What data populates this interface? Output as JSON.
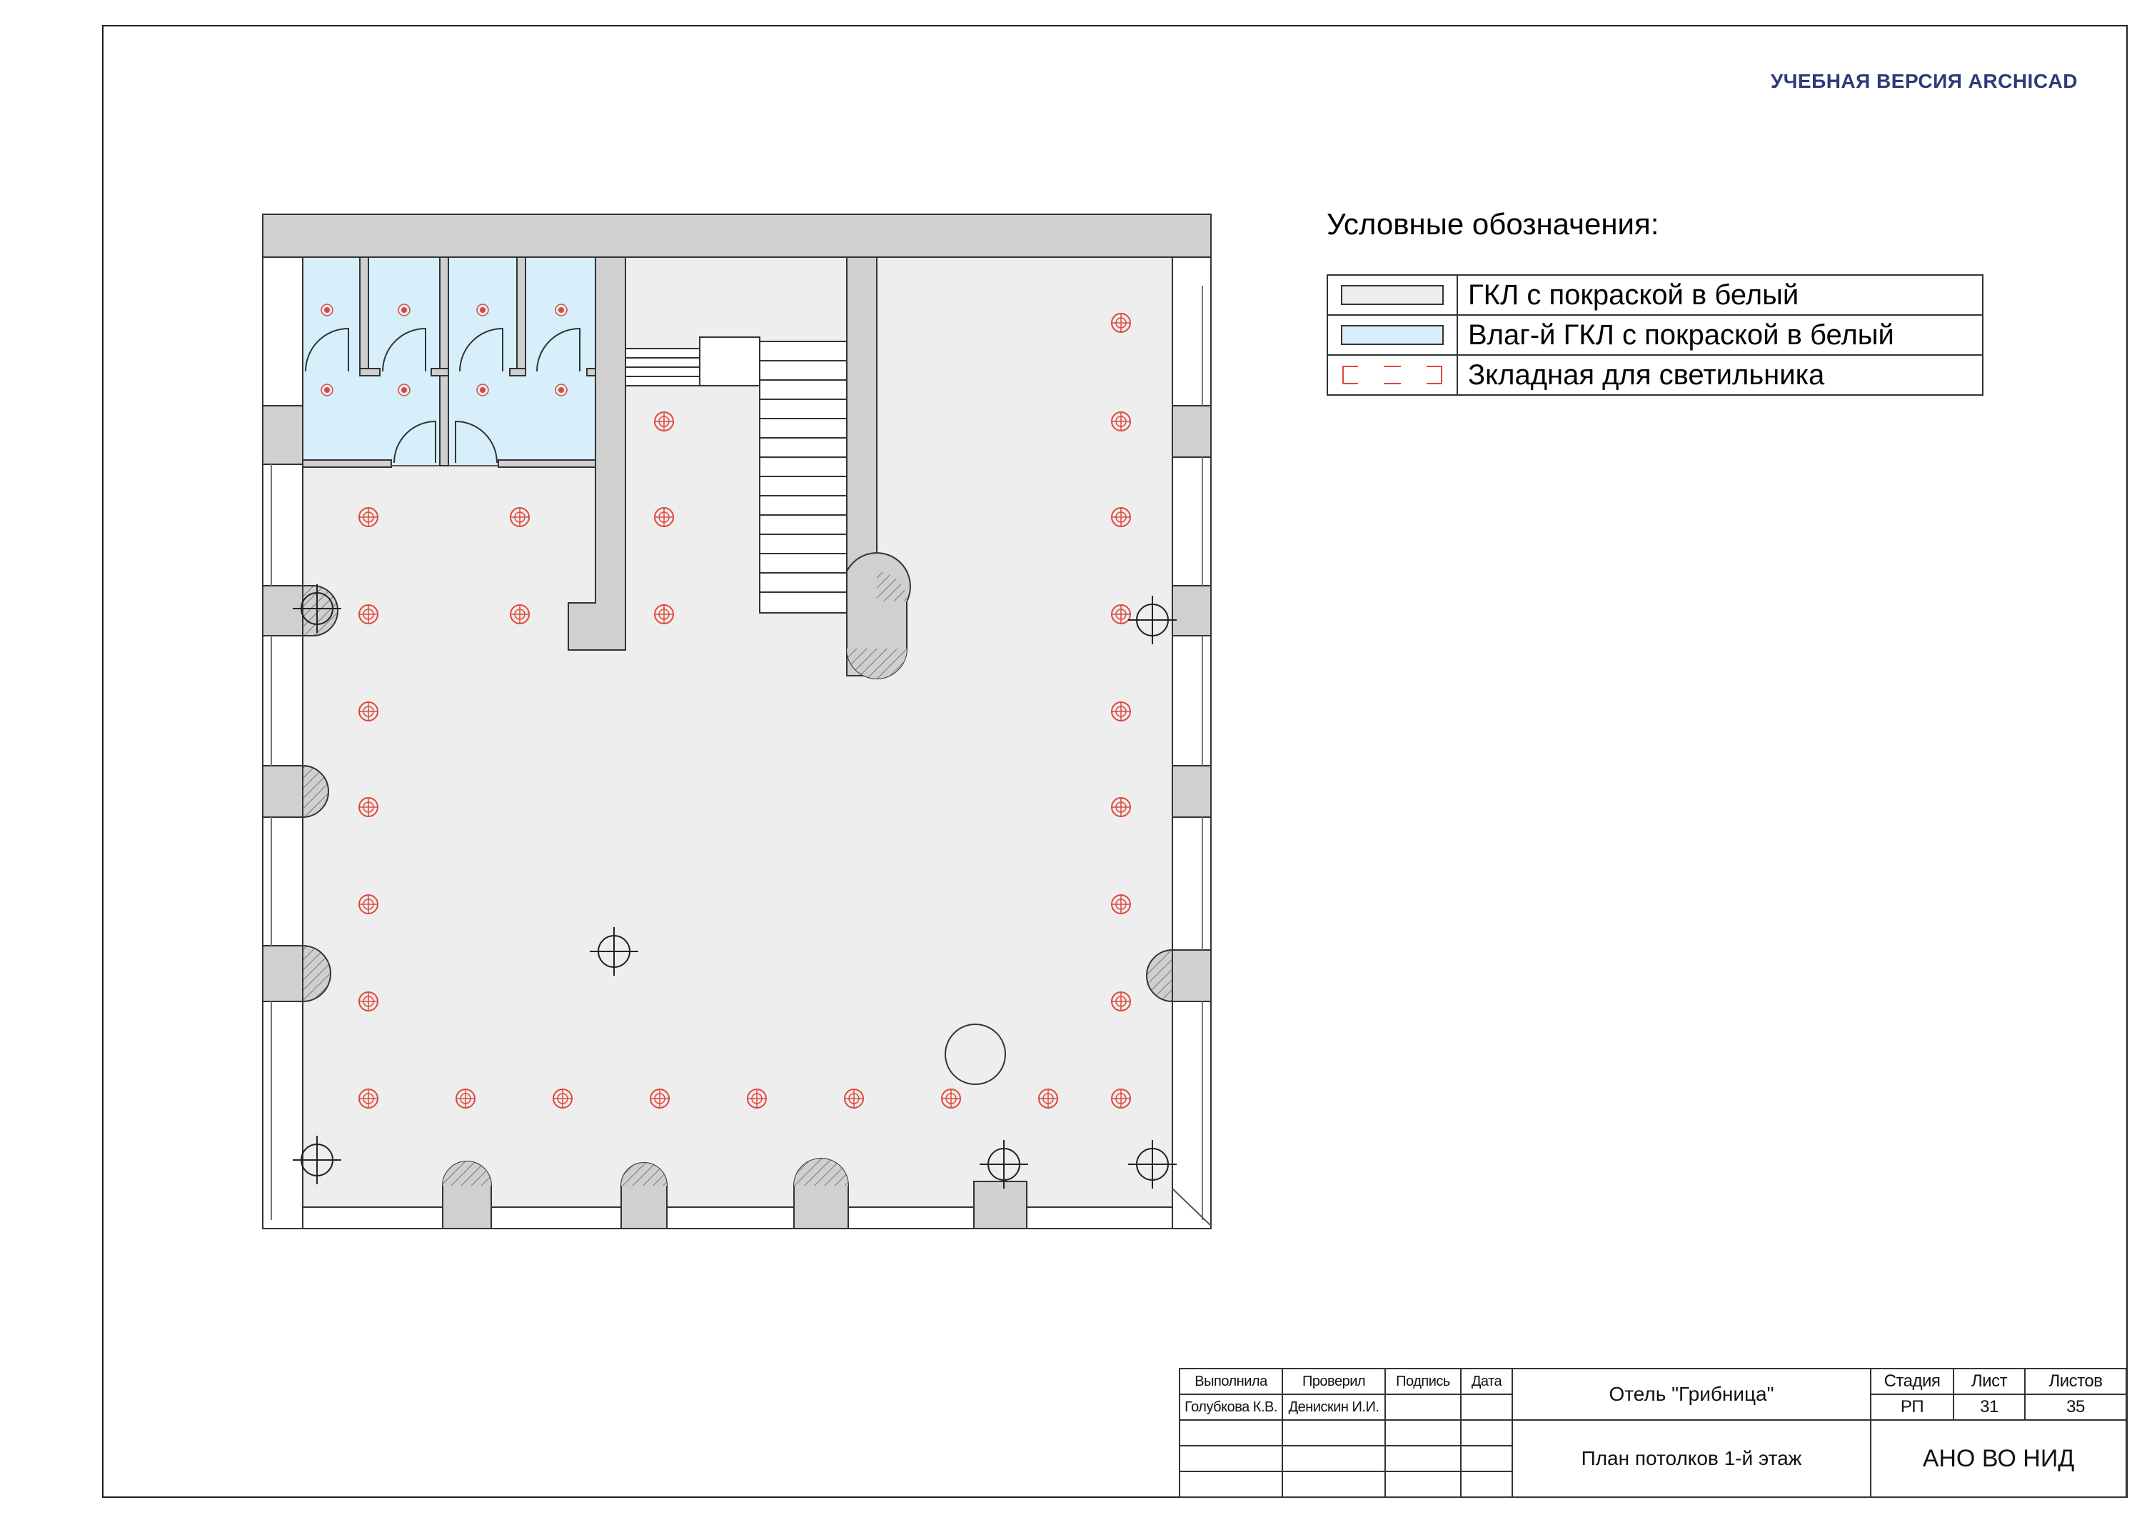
{
  "watermark": "УЧЕБНАЯ ВЕРСИЯ ARCHICAD",
  "legend": {
    "title": "Условные обозначения:",
    "items": [
      {
        "symbol": "grey-fill-swatch",
        "label": "ГКЛ с покраской в белый",
        "color": "#eeeeee"
      },
      {
        "symbol": "light-blue-fill-swatch",
        "label": "Влаг-й ГКЛ с покраской в белый",
        "color": "#d6effb"
      },
      {
        "symbol": "red-bracket-marks",
        "label": "Зкладная для светильника",
        "color": "#e0473a"
      }
    ]
  },
  "stamp": {
    "headers": {
      "performed": "Выполнила",
      "checked": "Проверил",
      "signature": "Подпись",
      "date": "Дата",
      "stage": "Стадия",
      "sheet": "Лист",
      "sheets": "Листов"
    },
    "performed_by": "Голубкова К.В.",
    "checked_by": "Денискин И.И.",
    "project": "Отель \"Грибница\"",
    "stage": "РП",
    "sheet": "31",
    "sheets": "35",
    "drawing": "План потолков 1-й этаж",
    "organization": "АНО ВО НИД"
  },
  "colors": {
    "ceiling_gkl": "#eeeeee",
    "ceiling_wet": "#d6effb",
    "wall": "#d0d0d0",
    "lamp": "#e0473a",
    "accent_watermark": "#2d3a78"
  }
}
